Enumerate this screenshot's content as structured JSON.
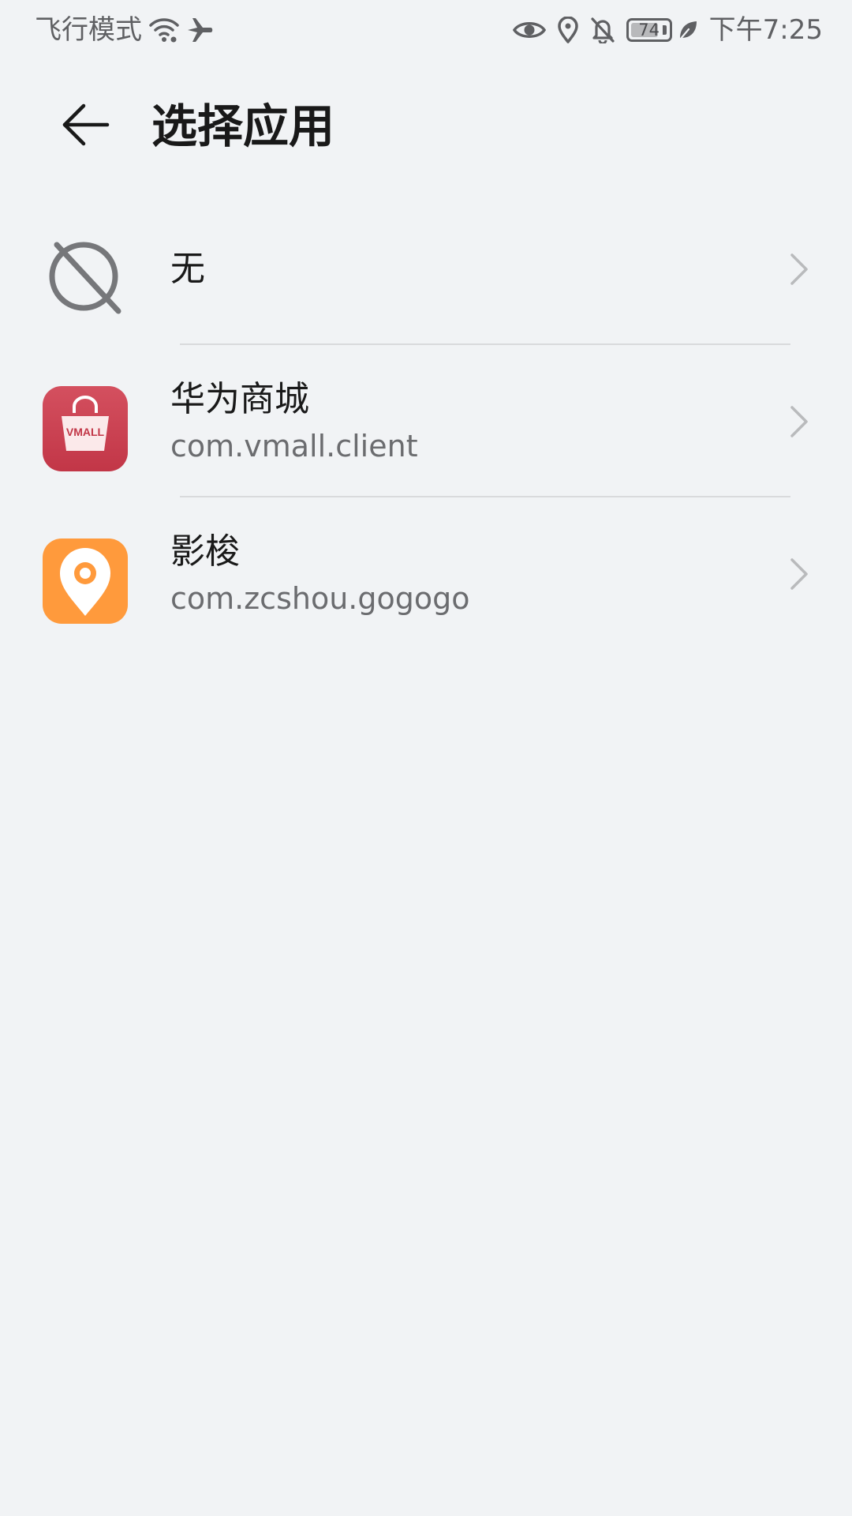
{
  "status_bar": {
    "mode_text": "飞行模式",
    "battery_level": "74",
    "battery_fraction": 0.74,
    "time": "下午7:25",
    "icons": [
      "wifi-icon",
      "airplane-icon",
      "eye-icon",
      "location-icon",
      "bell-off-icon",
      "battery-icon",
      "leaf-icon"
    ]
  },
  "header": {
    "title": "选择应用",
    "back_icon": "back-arrow-icon"
  },
  "list": {
    "items": [
      {
        "title": "无",
        "subtitle": "",
        "icon": "none-icon"
      },
      {
        "title": "华为商城",
        "subtitle": "com.vmall.client",
        "icon": "vmall-app-icon",
        "icon_text": "VMALL",
        "icon_color": "#c83c4e"
      },
      {
        "title": "影梭",
        "subtitle": "com.zcshou.gogogo",
        "icon": "location-pin-app-icon",
        "icon_color": "#ff9a3c"
      }
    ]
  },
  "colors": {
    "background": "#f1f3f5",
    "primary_text": "#191919",
    "secondary_text": "#6b6c6f",
    "divider": "#d9dadc"
  }
}
